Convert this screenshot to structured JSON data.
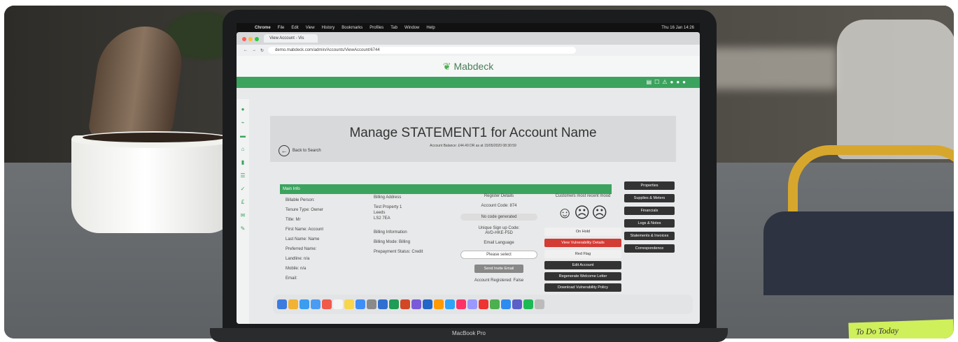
{
  "menubar": {
    "app": "Chrome",
    "items": [
      "File",
      "Edit",
      "View",
      "History",
      "Bookmarks",
      "Profiles",
      "Tab",
      "Window",
      "Help"
    ],
    "clock": "Thu 16 Jan 14:26"
  },
  "browser": {
    "tab_title": "View Account - Vis",
    "url": "demo.mabdeck.com/admin/Accounts/ViewAccount/6744"
  },
  "brand": {
    "name": "Mabdeck"
  },
  "page": {
    "title": "Manage STATEMENT1 for Account Name",
    "balance": "Account Balance: £44.49 DR as at 15/05/2020 08:30:59",
    "back_label": "Back to Search",
    "main_info": "Main Info"
  },
  "person": [
    "Billable Person:",
    "Tenure Type: Owner",
    "Title: Mr",
    "First Name: Account",
    "Last Name: Name",
    "Preferred Name:",
    "Landline: n/a",
    "Mobile: n/a",
    "Email:"
  ],
  "billing": {
    "address_label": "Billing Address",
    "address": [
      "Test Property 1",
      "Leeds",
      "LS2 7EA"
    ],
    "info_label": "Billing Information",
    "mode": "Billing Mode: Billing",
    "prepay": "Prepayment Status: Credit"
  },
  "register": {
    "heading": "Register Details",
    "code": "Account Code: 874",
    "no_code": "No code generated",
    "signup_label": "Unique Sign up Code:",
    "signup_code": "AVD-HKE-F5D",
    "email_lang": "Email Language",
    "select_placeholder": "Please select",
    "send_invite": "Send Invite Email",
    "registered": "Account Registered: False"
  },
  "mood": {
    "label": "Customers most recent mood",
    "faces": "☺☹☹"
  },
  "actions": {
    "on_hold": "On Hold",
    "vulnerability": "View Vulnerability Details",
    "red_flag": "Red Flag",
    "edit": "Edit Account",
    "regenerate": "Regenerate Welcome Letter",
    "download": "Download Vulnerability Policy"
  },
  "rightnav": [
    "Properties",
    "Supplies & Meters",
    "Financials",
    "Logs & Notes",
    "Statements & Invoices",
    "Correspondence"
  ],
  "laptop_label": "MacBook Pro",
  "sticky_note": "To Do Today",
  "colors": {
    "brand_green": "#3ba35e",
    "alert_red": "#d33b35",
    "chair_yellow": "#d7a72d",
    "sticky": "#cff05a"
  }
}
